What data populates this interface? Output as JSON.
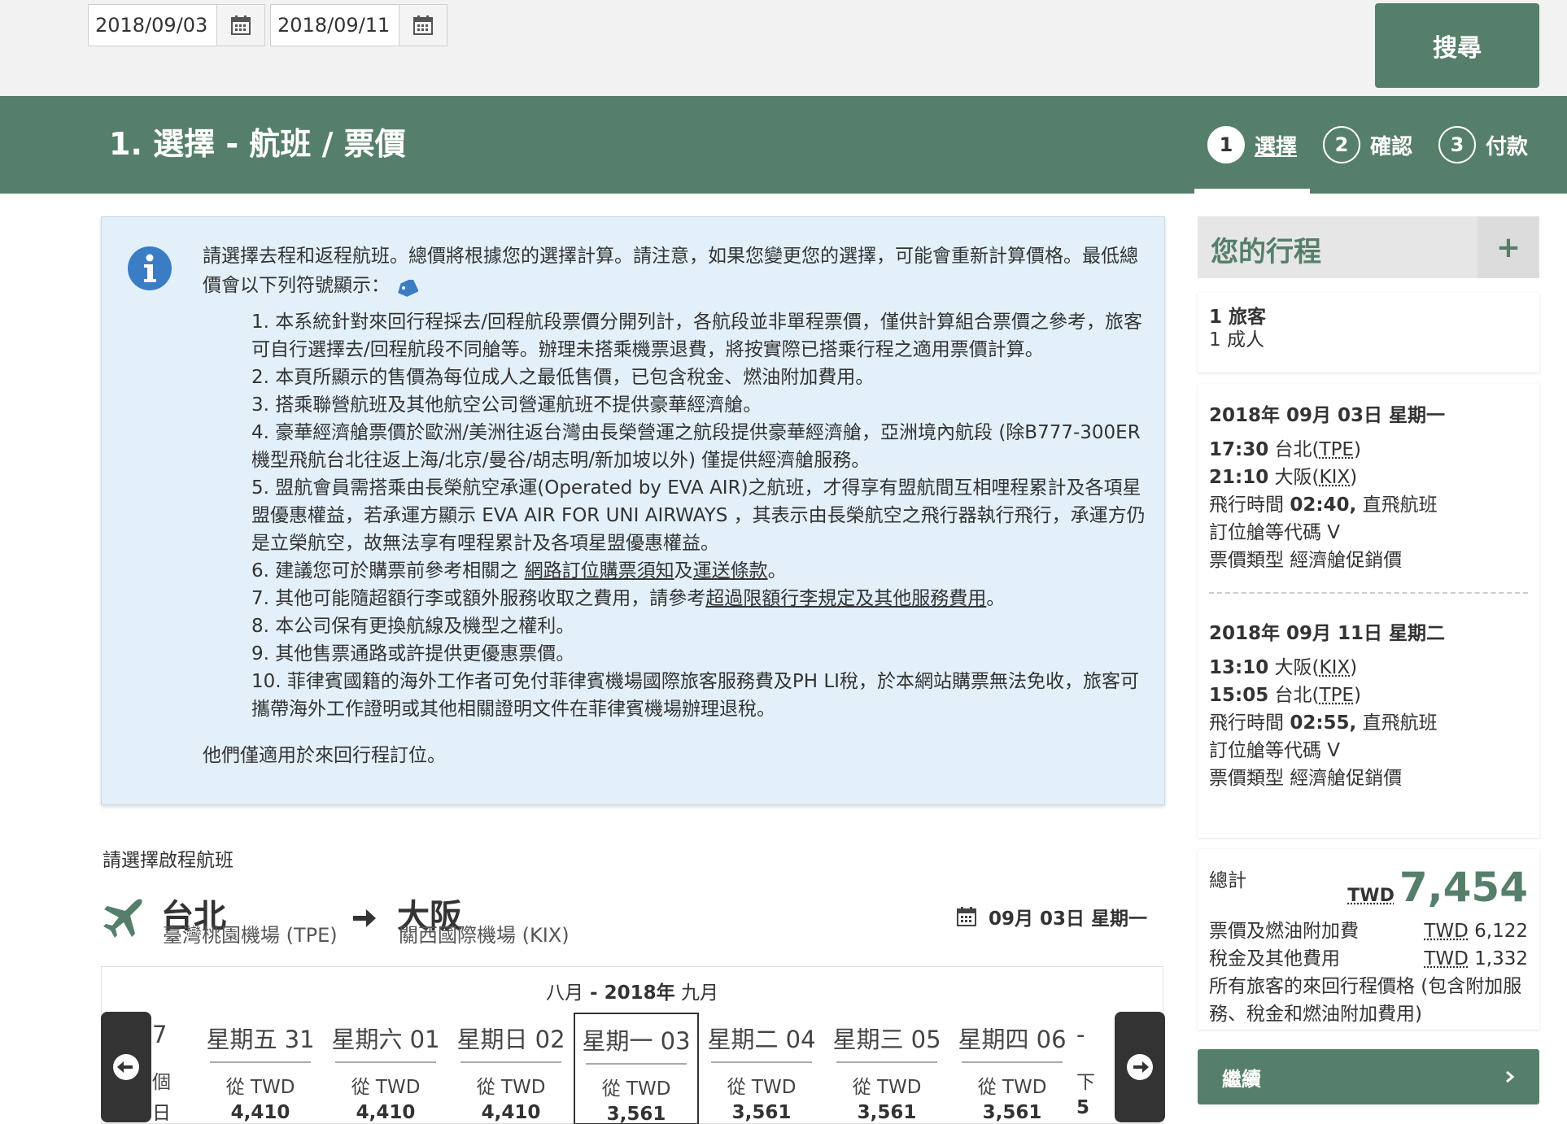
{
  "search": {
    "depart_date": "2018/09/03",
    "return_date": "2018/09/11",
    "search_label": "搜尋"
  },
  "header": {
    "title": "1. 選擇 - 航班 / 票價",
    "steps": [
      {
        "num": "1",
        "label": "選擇"
      },
      {
        "num": "2",
        "label": "確認"
      },
      {
        "num": "3",
        "label": "付款"
      }
    ]
  },
  "info": {
    "intro": "請選擇去程和返程航班。總價將根據您的選擇計算。請注意，如果您變更您的選擇，可能會重新計算價格。最低總價會以下列符號顯示：",
    "notes": [
      "1. 本系統針對來回行程採去/回程航段票價分開列計，各航段並非單程票價，僅供計算組合票價之參考，旅客可自行選擇去/回程航段不同艙等。辦理未搭乘機票退費，將按實際已搭乘行程之適用票價計算。",
      "2. 本頁所顯示的售價為每位成人之最低售價，已包含稅金、燃油附加費用。",
      "3. 搭乘聯營航班及其他航空公司營運航班不提供豪華經濟艙。",
      "4. 豪華經濟艙票價於歐洲/美洲往返台灣由長榮營運之航段提供豪華經濟艙，亞洲境內航段 (除B777-300ER機型飛航台北往返上海/北京/曼谷/胡志明/新加坡以外) 僅提供經濟艙服務。",
      "5. 盟航會員需搭乘由長榮航空承運(Operated by EVA AIR)之航班，才得享有盟航間互相哩程累計及各項星盟優惠權益，若承運方顯示 EVA AIR FOR UNI AIRWAYS ，其表示由長榮航空之飛行器執行飛行，承運方仍是立榮航空，故無法享有哩程累計及各項星盟優惠權益。"
    ],
    "note6_pre": "6. 建議您可於購票前參考相關之 ",
    "note6_link1": "網路訂位購票須知",
    "note6_mid": "及",
    "note6_link2": "運送條款",
    "note6_post": "。",
    "note7_pre": "7. 其他可能隨超額行李或額外服務收取之費用，請參考",
    "note7_link": "超過限額行李規定及其他服務費用",
    "note7_post": "。",
    "note8": "8. 本公司保有更換航線及機型之權利。",
    "note9": "9. 其他售票通路或許提供更優惠票價。",
    "note10": "10. 菲律賓國籍的海外工作者可免付菲律賓機場國際旅客服務費及PH LI稅，於本網站購票無法免收，旅客可攜帶海外工作證明或其他相關證明文件在菲律賓機場辦理退稅。",
    "footer": "他們僅適用於來回行程訂位。"
  },
  "outbound": {
    "label": "請選擇啟程航班",
    "from_city": "台北",
    "from_airport": "臺灣桃園機場 (TPE)",
    "to_city": "大阪",
    "to_airport": "關西國際機場 (KIX)",
    "date": "09月 03日 星期一"
  },
  "calendar": {
    "month_a": "八月",
    "sep": " - ",
    "year": "2018年",
    "month_b": "九月",
    "left_partial": {
      "l1": "7",
      "l2": "個",
      "l3": "日"
    },
    "right_partial": {
      "l1": "-",
      "l2": "下",
      "l3": "5"
    },
    "days": [
      {
        "name": "星期五 31",
        "from": "從 TWD",
        "price": "4,410"
      },
      {
        "name": "星期六 01",
        "from": "從 TWD",
        "price": "4,410"
      },
      {
        "name": "星期日 02",
        "from": "從 TWD",
        "price": "4,410"
      },
      {
        "name": "星期一 03",
        "from": "從 TWD",
        "price": "3,561"
      },
      {
        "name": "星期二 04",
        "from": "從 TWD",
        "price": "3,561"
      },
      {
        "name": "星期三 05",
        "from": "從 TWD",
        "price": "3,561"
      },
      {
        "name": "星期四 06",
        "from": "從 TWD",
        "price": "3,561"
      }
    ]
  },
  "itinerary": {
    "title": "您的行程",
    "plus": "+",
    "passengers": "1 旅客",
    "adults": "1 成人",
    "leg1": {
      "date": "2018年 09月 03日 星期一",
      "dep_time": "17:30",
      "dep_city": "台北(",
      "dep_code": "TPE",
      "arr_time": "21:10",
      "arr_city": "大阪(",
      "arr_code": "KIX",
      "duration_label": "飛行時間 ",
      "duration": "02:40,",
      "nonstop": " 直飛航班",
      "class_label": "訂位艙等代碼 V",
      "fare_label": "票價類型 經濟艙促銷價"
    },
    "leg2": {
      "date": "2018年 09月 11日 星期二",
      "dep_time": "13:10",
      "dep_city": "大阪(",
      "dep_code": "KIX",
      "arr_time": "15:05",
      "arr_city": "台北(",
      "arr_code": "TPE",
      "duration_label": "飛行時間 ",
      "duration": "02:55,",
      "nonstop": " 直飛航班",
      "class_label": "訂位艙等代碼 V",
      "fare_label": "票價類型 經濟艙促銷價"
    },
    "total": {
      "label": "總計",
      "currency": "TWD",
      "amount": "7,454",
      "fare_label": "票價及燃油附加費",
      "fare_cur": "TWD",
      "fare_amt": " 6,122",
      "tax_label": "稅金及其他費用",
      "tax_cur": "TWD",
      "tax_amt": " 1,332",
      "note": "所有旅客的來回行程價格 (包含附加服務、稅金和燃油附加費用)"
    },
    "continue_label": "繼續"
  },
  "colors": {
    "brand_green": "#567f6b",
    "info_bg": "#e3f0fa",
    "info_icon": "#3b7dc4"
  }
}
